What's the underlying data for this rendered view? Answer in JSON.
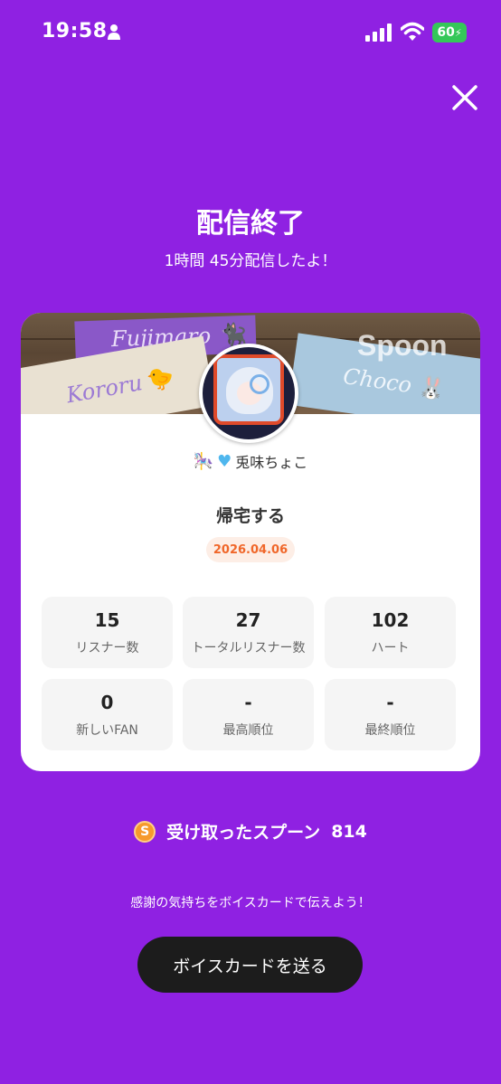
{
  "status_bar": {
    "time": "19:58",
    "battery": "60"
  },
  "header": {
    "title": "配信終了",
    "subtitle": "1時間 45分配信したよ！"
  },
  "card": {
    "banner": {
      "tags": [
        "Fujimaro",
        "Kororu",
        "Choco"
      ],
      "watermark": "Spoon"
    },
    "username": "兎味ちょこ",
    "stream_title": "帰宅する",
    "date": "2026.04.06",
    "stats": [
      {
        "value": "15",
        "label": "リスナー数"
      },
      {
        "value": "27",
        "label": "トータルリスナー数"
      },
      {
        "value": "102",
        "label": "ハート"
      },
      {
        "value": "0",
        "label": "新しいFAN"
      },
      {
        "value": "-",
        "label": "最高順位"
      },
      {
        "value": "-",
        "label": "最終順位"
      }
    ]
  },
  "spoons": {
    "coin_letter": "S",
    "label": "受け取ったスプーン",
    "count": "814"
  },
  "thanks_text": "感謝の気持ちをボイスカードで伝えよう！",
  "voice_card_button": "ボイスカードを送る",
  "colors": {
    "background": "#8f21e2",
    "date_text": "#f0672a",
    "coin": "#f69a2c"
  }
}
